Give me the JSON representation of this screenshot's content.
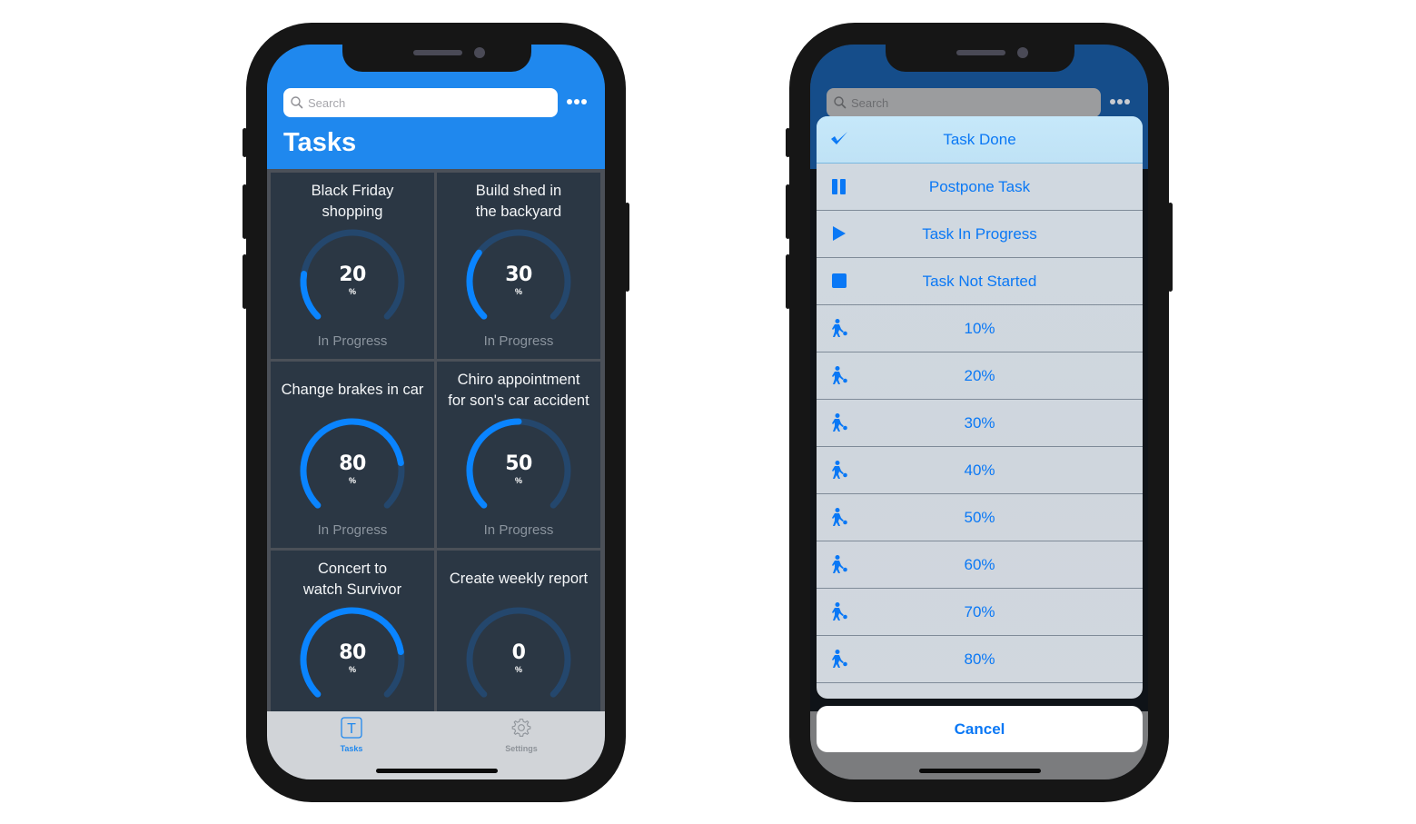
{
  "left_phone": {
    "search": {
      "placeholder": "Search"
    },
    "title": "Tasks",
    "tasks": [
      {
        "title_lines": [
          "Black Friday",
          "shopping"
        ],
        "percent": 20,
        "status": "In Progress"
      },
      {
        "title_lines": [
          "Build shed in",
          "the backyard"
        ],
        "percent": 30,
        "status": "In Progress"
      },
      {
        "title_lines": [
          "Change brakes in car"
        ],
        "percent": 80,
        "status": "In Progress"
      },
      {
        "title_lines": [
          "Chiro appointment",
          "for son's car accident"
        ],
        "percent": 50,
        "status": "In Progress"
      },
      {
        "title_lines": [
          "Concert to",
          "watch Survivor"
        ],
        "percent": 80,
        "status": ""
      },
      {
        "title_lines": [
          "Create weekly report"
        ],
        "percent": 0,
        "status": ""
      }
    ],
    "percent_symbol": "%",
    "tabbar": {
      "tabs": [
        {
          "label": "Tasks",
          "icon": "letter-t-icon",
          "icon_glyph": "T",
          "active": true
        },
        {
          "label": "Settings",
          "icon": "gear-icon",
          "active": false
        }
      ]
    }
  },
  "right_phone": {
    "search": {
      "placeholder": "Search"
    },
    "action_sheet": {
      "items": [
        {
          "label": "Task Done",
          "icon": "checkmark-icon",
          "highlighted": true
        },
        {
          "label": "Postpone Task",
          "icon": "pause-icon"
        },
        {
          "label": "Task In Progress",
          "icon": "play-icon"
        },
        {
          "label": "Task Not Started",
          "icon": "stop-icon"
        },
        {
          "label": "10%",
          "icon": "worker-icon"
        },
        {
          "label": "20%",
          "icon": "worker-icon"
        },
        {
          "label": "30%",
          "icon": "worker-icon"
        },
        {
          "label": "40%",
          "icon": "worker-icon"
        },
        {
          "label": "50%",
          "icon": "worker-icon"
        },
        {
          "label": "60%",
          "icon": "worker-icon"
        },
        {
          "label": "70%",
          "icon": "worker-icon"
        },
        {
          "label": "80%",
          "icon": "worker-icon"
        }
      ],
      "cancel_label": "Cancel"
    }
  },
  "colors": {
    "accent": "#1f88ee",
    "action_text": "#0a78f5",
    "gauge_track": "#24476d",
    "gauge_fill": "#0a84ff",
    "card_bg": "#2b3744"
  }
}
